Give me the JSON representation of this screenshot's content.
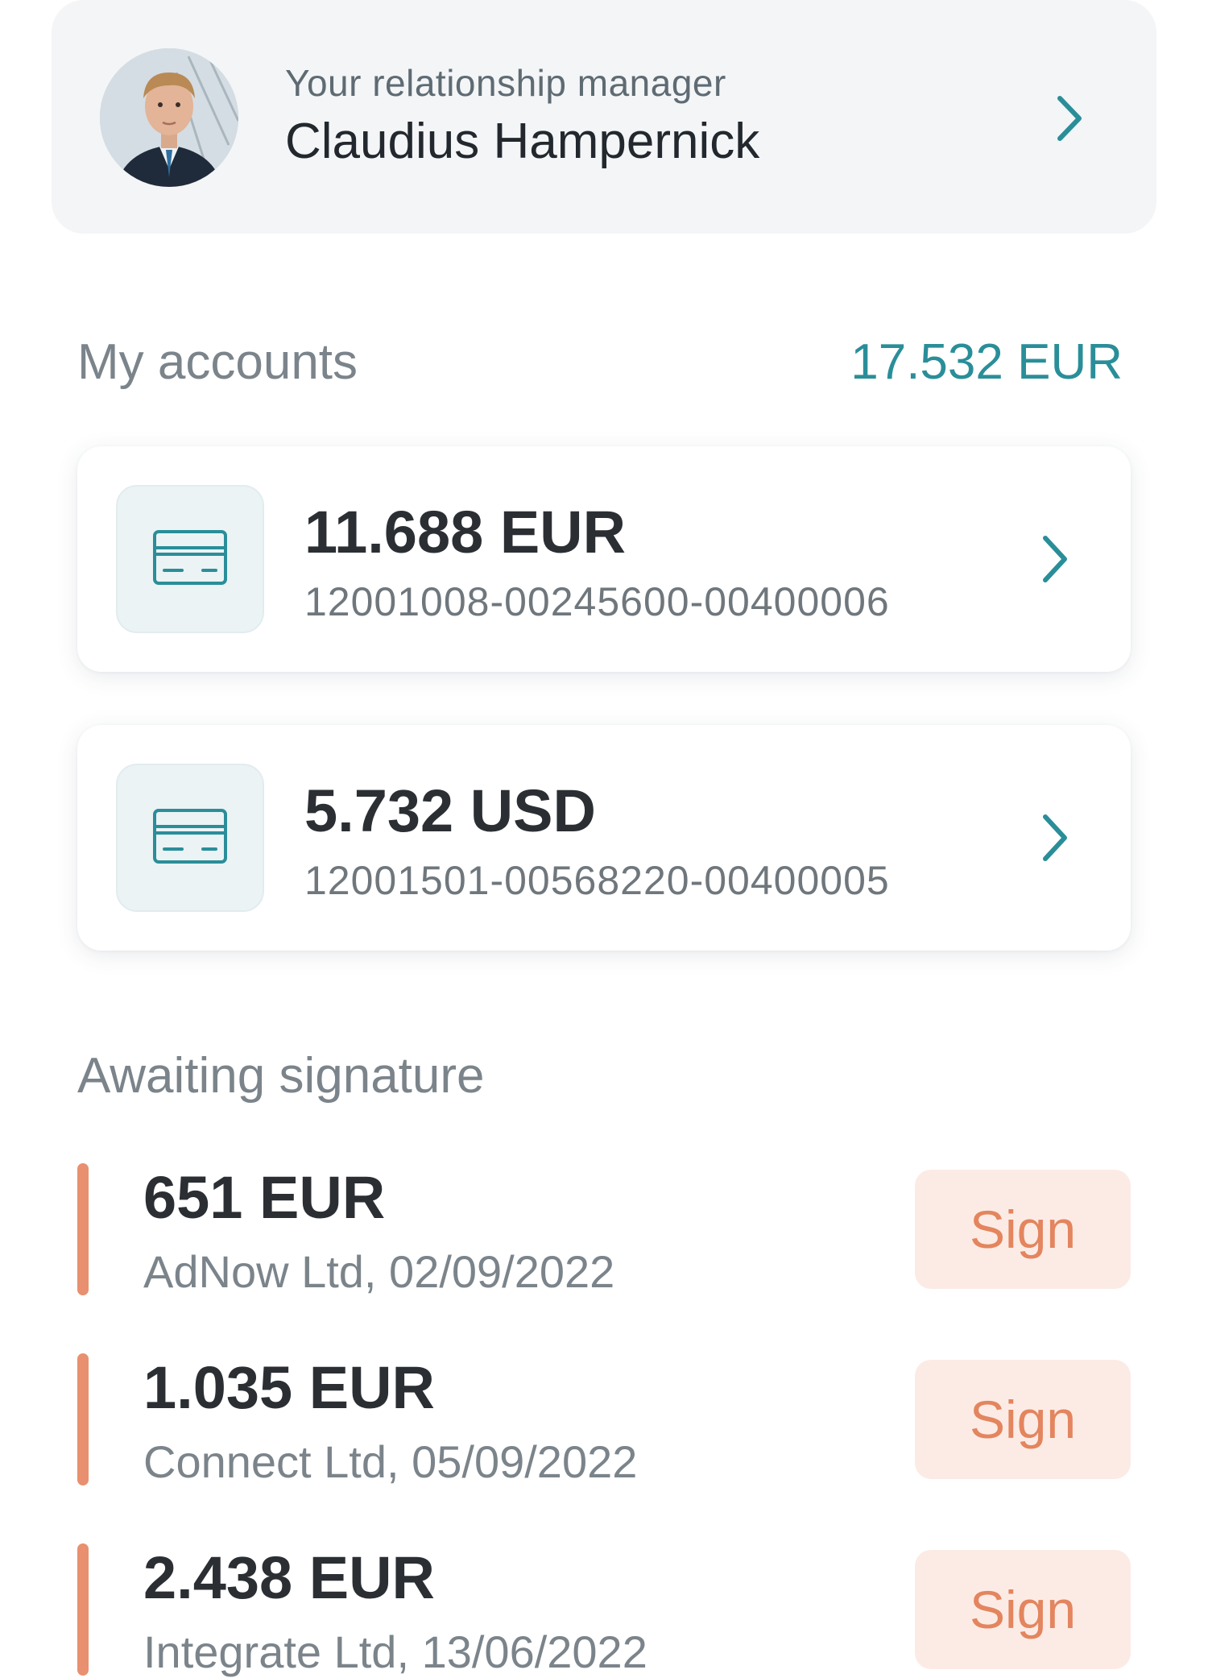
{
  "relationship_manager": {
    "label": "Your relationship manager",
    "name": "Claudius Hampernick",
    "avatar": "manager-photo",
    "chevron_icon": "chevron-right-icon"
  },
  "accounts": {
    "title": "My accounts",
    "total": "17.532 EUR",
    "items": [
      {
        "amount": "11.688 EUR",
        "number": "12001008-00245600-00400006",
        "icon": "credit-card-icon"
      },
      {
        "amount": "5.732 USD",
        "number": "12001501-00568220-00400005",
        "icon": "credit-card-icon"
      }
    ]
  },
  "awaiting_signature": {
    "title": "Awaiting signature",
    "items": [
      {
        "amount": "651 EUR",
        "description": "AdNow Ltd, 02/09/2022",
        "button_label": "Sign"
      },
      {
        "amount": "1.035 EUR",
        "description": "Connect Ltd, 05/09/2022",
        "button_label": "Sign"
      },
      {
        "amount": "2.438 EUR",
        "description": "Integrate Ltd, 13/06/2022",
        "button_label": "Sign"
      }
    ]
  },
  "colors": {
    "accent_teal": "#2a8e99",
    "pending_orange": "#e8906f",
    "sign_button_bg": "#fcebe5",
    "card_bg": "#f3f5f7"
  }
}
